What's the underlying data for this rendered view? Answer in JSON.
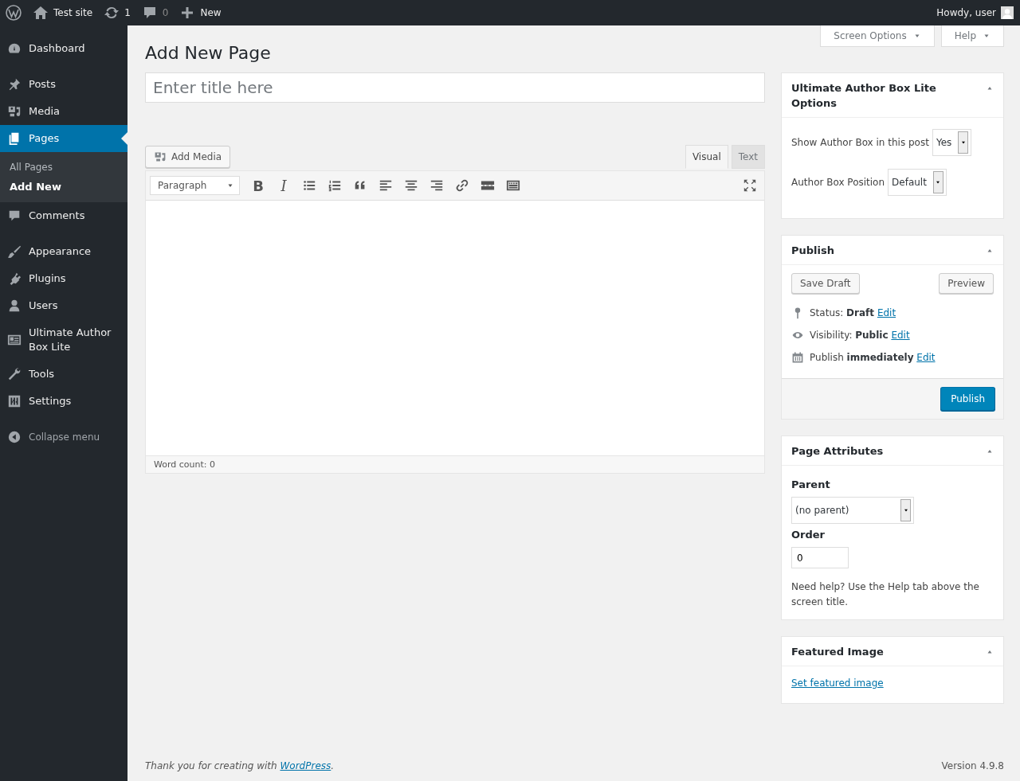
{
  "admin_bar": {
    "site": "Test site",
    "updates": "1",
    "comments": "0",
    "new": "New",
    "greeting": "Howdy, user"
  },
  "sidebar": {
    "groups": [
      [
        {
          "label": "Dashboard",
          "selected": false
        }
      ],
      [
        {
          "label": "Posts",
          "selected": false
        },
        {
          "label": "Media",
          "selected": false
        },
        {
          "label": "Pages",
          "selected": true,
          "children": [
            {
              "label": "All Pages",
              "selected": false
            },
            {
              "label": "Add New",
              "selected": true
            }
          ]
        },
        {
          "label": "Comments",
          "selected": false
        }
      ],
      [
        {
          "label": "Appearance",
          "selected": false
        },
        {
          "label": "Plugins",
          "selected": false
        },
        {
          "label": "Users",
          "selected": false
        },
        {
          "label": "Ultimate Author Box Lite",
          "selected": false
        },
        {
          "label": "Tools",
          "selected": false
        },
        {
          "label": "Settings",
          "selected": false
        }
      ]
    ],
    "collapse": "Collapse menu"
  },
  "screen_meta": [
    "Screen Options",
    "Help"
  ],
  "page_title": "Add New Page",
  "title_field": {
    "placeholder": "Enter title here"
  },
  "editor": {
    "add_media": "Add Media",
    "tabs": [
      {
        "label": "Visual",
        "selected": true
      },
      {
        "label": "Text",
        "selected": false
      }
    ],
    "format": "Paragraph",
    "bold": "B",
    "italic": "I",
    "word_count": "Word count: 0"
  },
  "author_box": {
    "title": "Ultimate Author Box Lite Options",
    "fields": [
      {
        "label": "Show Author Box in this post",
        "value": "Yes"
      },
      {
        "label": "Author Box Position",
        "value": "Default"
      }
    ]
  },
  "publish": {
    "title": "Publish",
    "save_draft": "Save Draft",
    "preview": "Preview",
    "rows": [
      {
        "text": "Status: **Draft**",
        "link": "Edit"
      },
      {
        "text": "Visibility: **Public**",
        "link": "Edit"
      },
      {
        "text": "Publish **immediately**",
        "link": "Edit"
      }
    ],
    "button": "Publish"
  },
  "page_attributes": {
    "title": "Page Attributes",
    "parent_label": "Parent",
    "parent_value": "(no parent)",
    "order_label": "Order",
    "order_value": "0",
    "help": "Need help? Use the Help tab above the screen title."
  },
  "featured_image": {
    "title": "Featured Image",
    "link": "Set featured image"
  },
  "footer": {
    "text": "Thank you for creating with ",
    "link": "WordPress",
    "end": ".",
    "version": "Version 4.9.8"
  }
}
